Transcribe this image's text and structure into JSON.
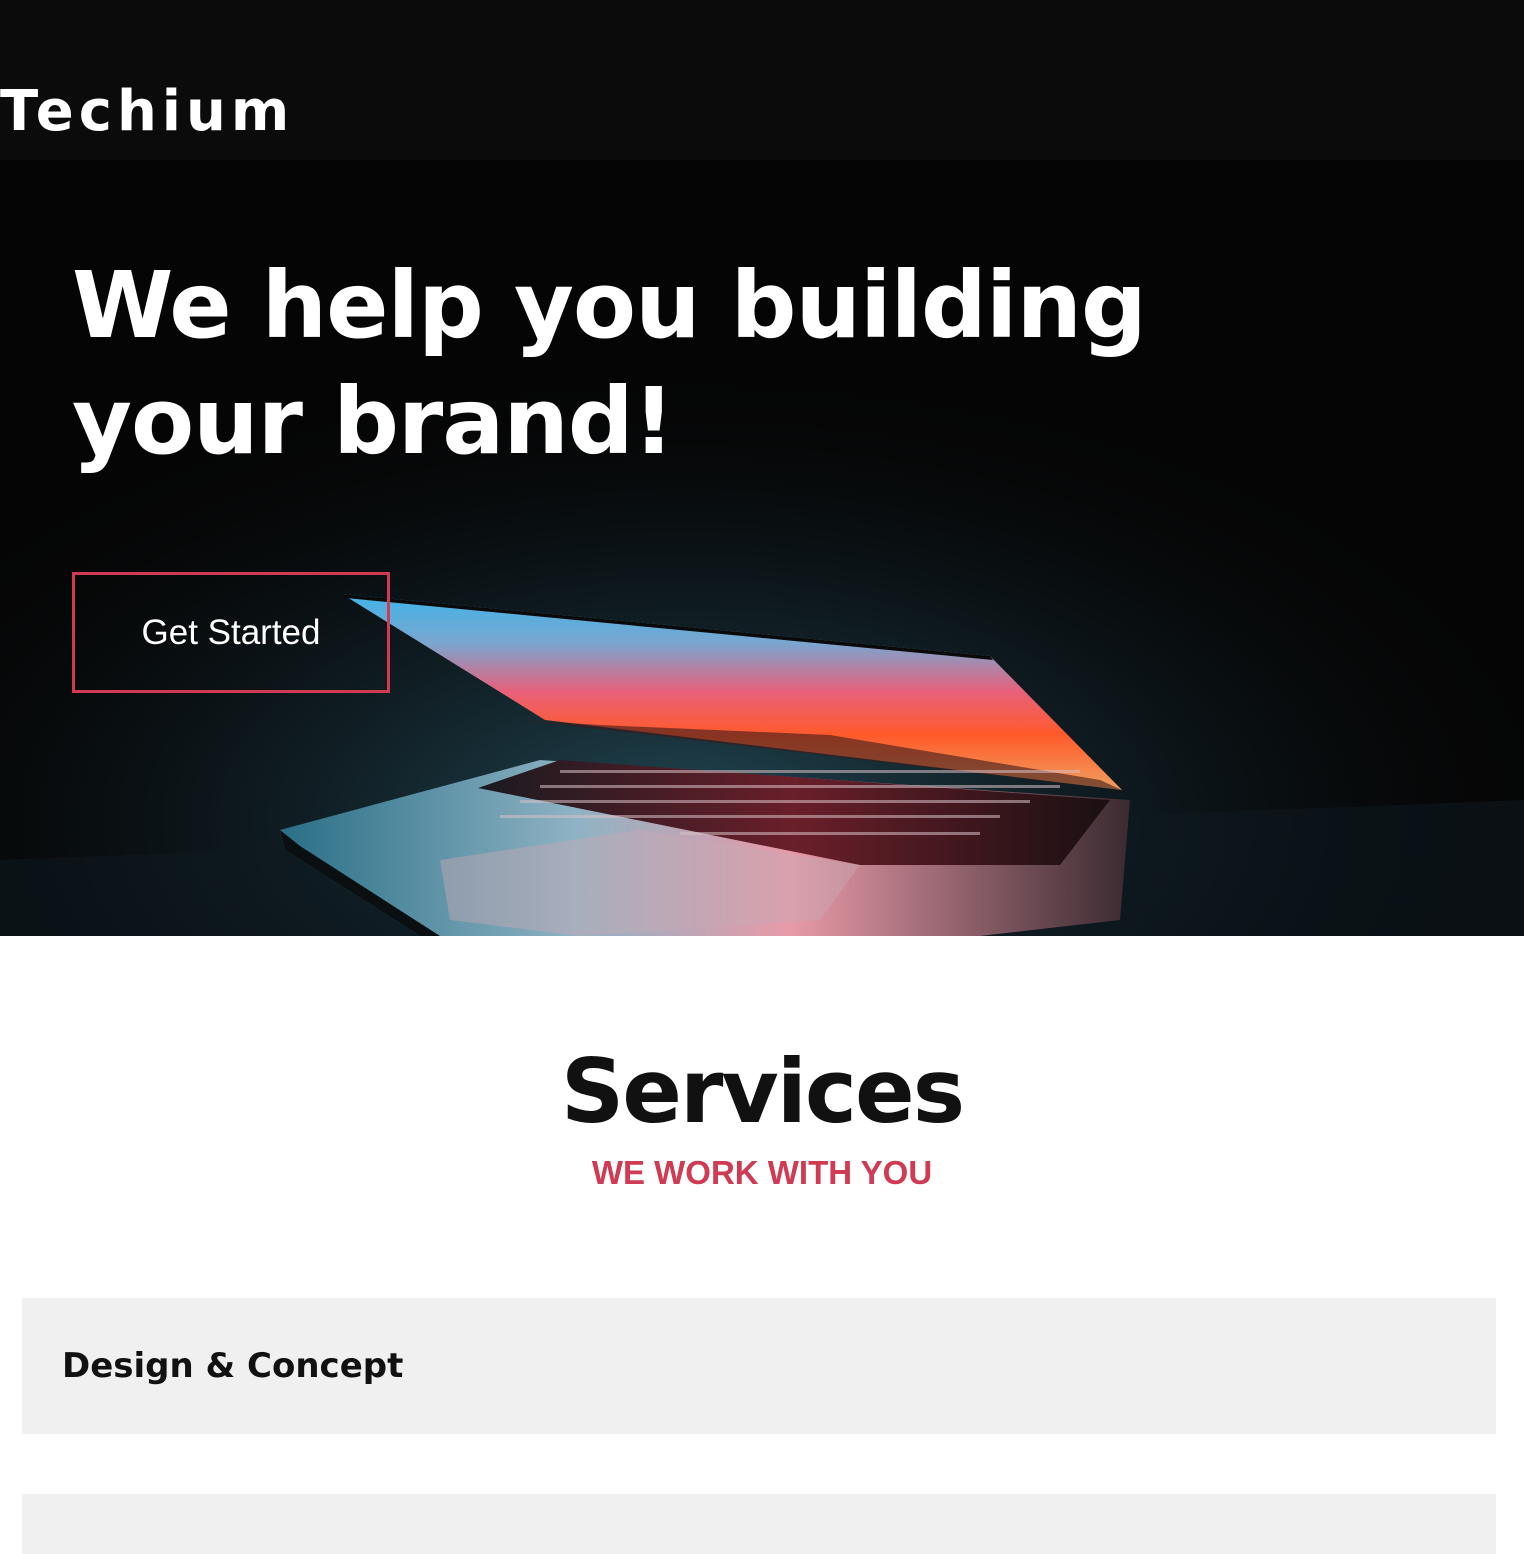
{
  "brand": {
    "logo_text": "Techium"
  },
  "hero": {
    "title": "We help you building your brand!",
    "cta_label": "Get Started",
    "image": "laptop-photo"
  },
  "services": {
    "title": "Services",
    "subtitle": "WE WORK WITH YOU",
    "items": [
      {
        "title": "Design & Concept"
      },
      {
        "title": ""
      }
    ]
  },
  "colors": {
    "accent": "#d03a52",
    "header_bg": "#0b0b0b",
    "card_bg": "#f0f0f0",
    "text_dark": "#111111"
  }
}
